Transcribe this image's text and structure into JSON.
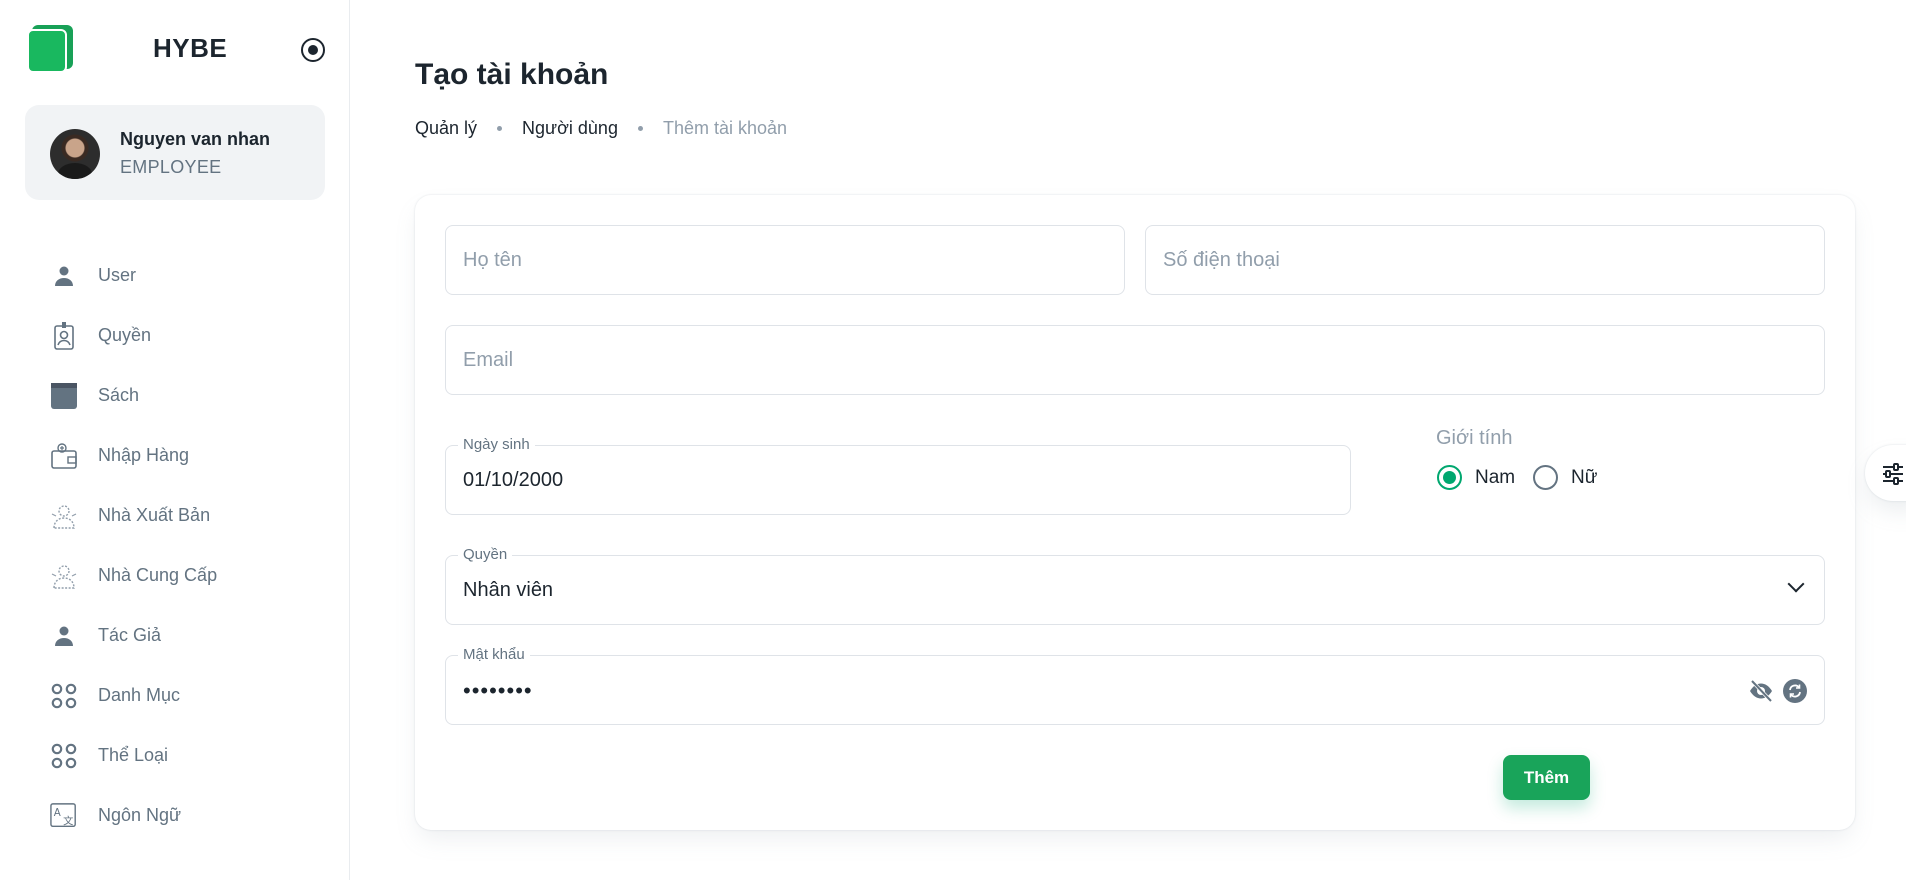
{
  "brand": {
    "name": "HYBE"
  },
  "user": {
    "name": "Nguyen van nhan",
    "role": "EMPLOYEE"
  },
  "sidebar": {
    "items": [
      {
        "label": "User",
        "icon": "user-icon"
      },
      {
        "label": "Quyền",
        "icon": "badge-icon"
      },
      {
        "label": "Sách",
        "icon": "book-icon"
      },
      {
        "label": "Nhập Hàng",
        "icon": "wallet-import-icon"
      },
      {
        "label": "Nhà Xuất Bản",
        "icon": "publisher-icon"
      },
      {
        "label": "Nhà Cung Cấp",
        "icon": "supplier-icon"
      },
      {
        "label": "Tác Giả",
        "icon": "author-icon"
      },
      {
        "label": "Danh Mục",
        "icon": "category-grid-icon"
      },
      {
        "label": "Thể Loại",
        "icon": "genre-grid-icon"
      },
      {
        "label": "Ngôn Ngữ",
        "icon": "language-icon"
      }
    ]
  },
  "page": {
    "title": "Tạo tài khoản",
    "breadcrumb": [
      "Quản lý",
      "Người dùng",
      "Thêm tài khoản"
    ]
  },
  "form": {
    "full_name": {
      "placeholder": "Họ tên",
      "value": ""
    },
    "phone": {
      "placeholder": "Số điện thoại",
      "value": ""
    },
    "email": {
      "placeholder": "Email",
      "value": ""
    },
    "birthday": {
      "label": "Ngày sinh",
      "value": "01/10/2000"
    },
    "gender": {
      "label": "Giới tính",
      "options": [
        "Nam",
        "Nữ"
      ],
      "selected": "Nam"
    },
    "role": {
      "label": "Quyền",
      "value": "Nhân viên"
    },
    "password": {
      "label": "Mật khẩu",
      "value": "••••••••"
    },
    "submit_label": "Thêm"
  },
  "colors": {
    "primary": "#00a76f",
    "button": "#19a45a",
    "text": "#1c252e",
    "muted": "#637381",
    "placeholder": "#919eab"
  }
}
